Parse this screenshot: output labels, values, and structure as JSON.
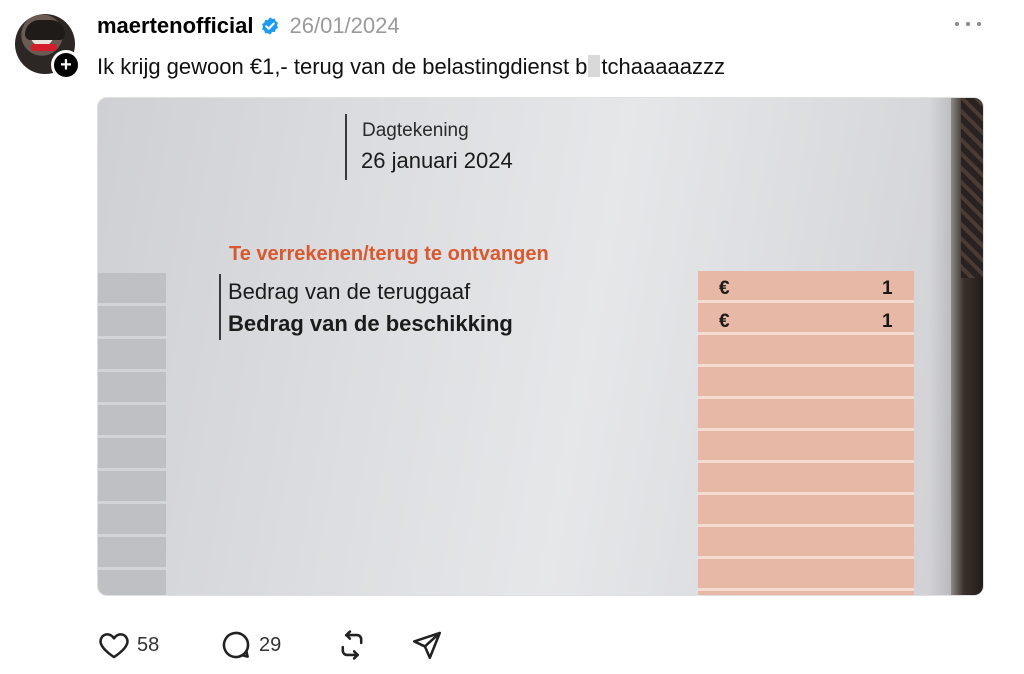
{
  "post": {
    "username": "maertenofficial",
    "verified_icon": "verified-badge-icon",
    "date": "26/01/2024",
    "caption_before": "Ik krijg gewoon €1,- terug van de belastingdienst b",
    "caption_after": "tchaaaaazzz",
    "more_icon": "more-dots-icon"
  },
  "photo": {
    "dagtekening_label": "Dagtekening",
    "dagtekening_date": "26 januari 2024",
    "section_title": "Te verrekenen/terug te ontvangen",
    "rows": [
      {
        "label": "Bedrag van de teruggaaf",
        "currency": "€",
        "value": "1"
      },
      {
        "label": "Bedrag van de beschikking",
        "currency": "€",
        "value": "1"
      }
    ]
  },
  "actions": {
    "likes": "58",
    "replies": "29",
    "like_icon": "heart-icon",
    "reply_icon": "comment-icon",
    "repost_icon": "repost-icon",
    "share_icon": "send-icon"
  },
  "colors": {
    "verified_blue": "#1d9bf0",
    "section_orange": "#d9582d",
    "date_gray": "#9a9a9a"
  }
}
